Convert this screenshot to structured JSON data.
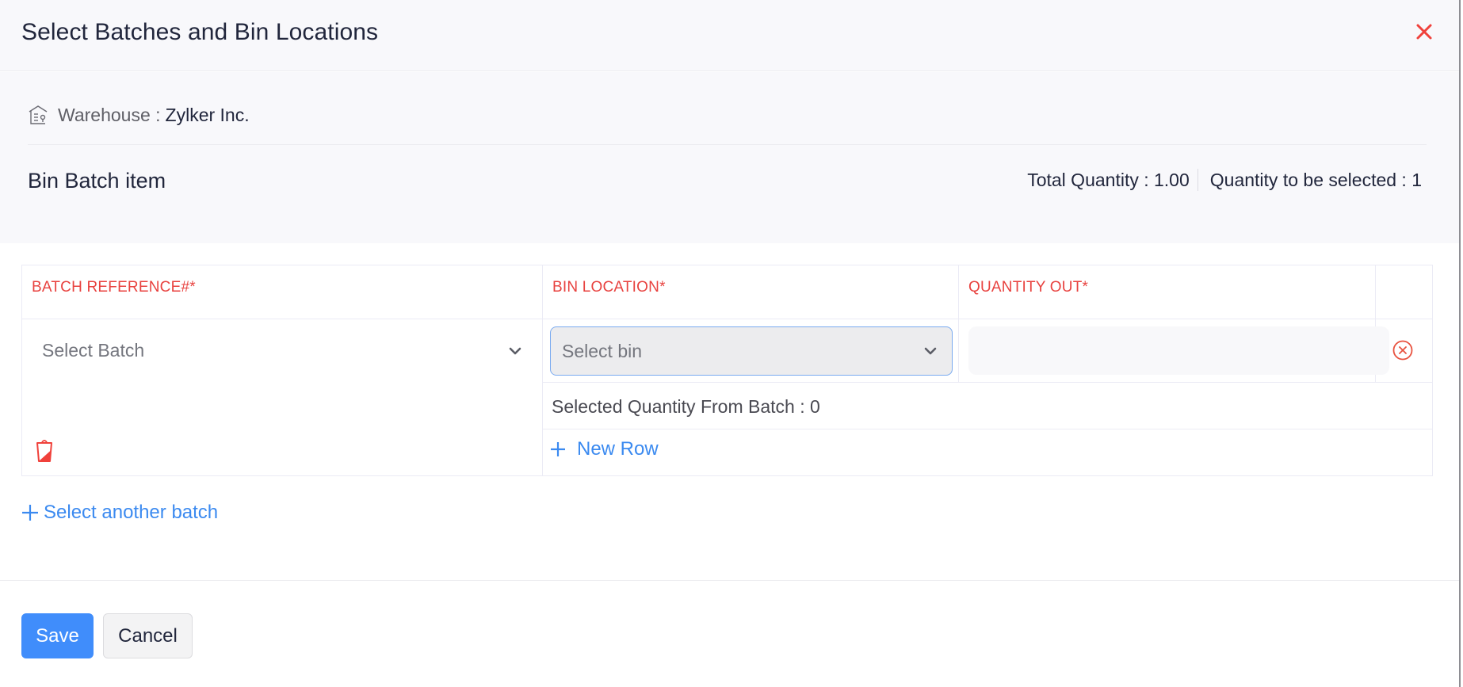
{
  "dialog": {
    "title": "Select Batches and Bin Locations",
    "close_icon": "close-icon"
  },
  "info": {
    "warehouse_icon": "warehouse-icon",
    "warehouse_label": "Warehouse :",
    "warehouse_value": "Zylker Inc.",
    "item_name": "Bin Batch item",
    "total_quantity": "Total Quantity : 1.00",
    "quantity_to_select": "Quantity to be selected : 1"
  },
  "table": {
    "columns": [
      "BATCH REFERENCE#*",
      "BIN LOCATION*",
      "QUANTITY OUT*"
    ],
    "rows": [
      {
        "batch_placeholder": "Select Batch",
        "bin_placeholder": "Select bin",
        "quantity_out": "",
        "selected_quantity_text": "Selected Quantity From Batch : 0"
      }
    ],
    "new_row_label": "New Row"
  },
  "actions": {
    "select_another_batch": "Select another batch",
    "save_label": "Save",
    "cancel_label": "Cancel"
  },
  "colors": {
    "accent": "#408dfb",
    "link": "#3b8af0",
    "required": "#e8423f",
    "close": "#f0413b"
  }
}
